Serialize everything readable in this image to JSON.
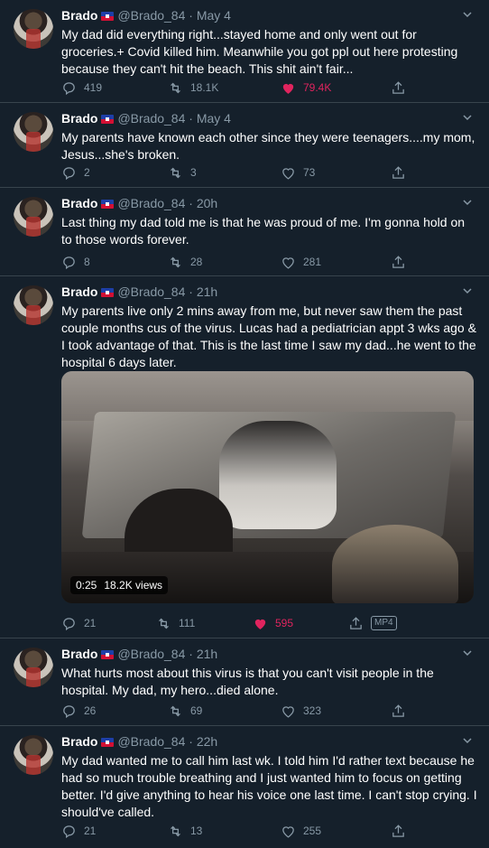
{
  "colors": {
    "background": "#15202b",
    "text": "#ffffff",
    "muted": "#8899a6",
    "divider": "#38444d",
    "like": "#e0245e"
  },
  "tweets": [
    {
      "name": "Brado",
      "handle": "@Brado_84",
      "sep": "·",
      "time": "May 4",
      "text": "My dad did everything right...stayed home and only went out for groceries.+ Covid killed him. Meanwhile you got ppl out here protesting because they can't hit the beach. This shit ain't fair...",
      "replies": "419",
      "retweets": "18.1K",
      "likes": "79.4K",
      "liked": true
    },
    {
      "name": "Brado",
      "handle": "@Brado_84",
      "sep": "·",
      "time": "May 4",
      "text": "My parents have known each other since they were teenagers....my mom, Jesus...she's broken.",
      "replies": "2",
      "retweets": "3",
      "likes": "73",
      "liked": false
    },
    {
      "name": "Brado",
      "handle": "@Brado_84",
      "sep": "·",
      "time": "20h",
      "text": "Last thing my dad told me is that he was proud of me. I'm gonna hold on to those words forever.",
      "replies": "8",
      "retweets": "28",
      "likes": "281",
      "liked": false
    },
    {
      "name": "Brado",
      "handle": "@Brado_84",
      "sep": "·",
      "time": "21h",
      "text": "My parents live only 2 mins away from me, but never saw them the past couple months cus of the virus. Lucas had a pediatrician appt 3 wks ago & I took advantage of that. This is the last time I saw my dad...he went to the hospital 6 days later.",
      "video_duration": "0:25",
      "video_views": "18.2K views",
      "video_format": "MP4",
      "replies": "21",
      "retweets": "111",
      "likes": "595",
      "liked": true
    },
    {
      "name": "Brado",
      "handle": "@Brado_84",
      "sep": "·",
      "time": "21h",
      "text": "What hurts most about this virus is that you can't visit people in the hospital. My dad, my hero...died alone.",
      "replies": "26",
      "retweets": "69",
      "likes": "323",
      "liked": false
    },
    {
      "name": "Brado",
      "handle": "@Brado_84",
      "sep": "·",
      "time": "22h",
      "text": "My dad wanted me to call him last wk. I told him I'd rather text because he had so much trouble breathing and I just wanted him to focus on getting better. I'd give anything to hear his voice one last time. I can't stop crying. I should've called.",
      "replies": "21",
      "retweets": "13",
      "likes": "255",
      "liked": false
    }
  ]
}
